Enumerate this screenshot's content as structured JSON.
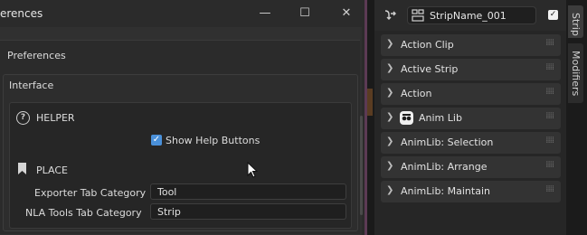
{
  "window": {
    "title": "erences",
    "minimize_glyph": "—",
    "maximize_glyph": "☐",
    "close_glyph": "✕"
  },
  "prefs": {
    "section_title": "Preferences",
    "interface_label": "Interface",
    "helper_label": "HELPER",
    "show_help_label": "Show Help Buttons",
    "show_help_checked": true,
    "place_label": "PLACE",
    "exporter_tab_label": "Exporter Tab Category",
    "exporter_tab_value": "Tool",
    "nla_tab_label": "NLA Tools Tab Category",
    "nla_tab_value": "Strip"
  },
  "sidebar": {
    "strip_name": "StripName_001",
    "strip_checked": true,
    "panels": [
      {
        "label": "Action Clip"
      },
      {
        "label": "Active Strip"
      },
      {
        "label": "Action"
      },
      {
        "label": "Anim Lib",
        "icon": "animlib-icon"
      },
      {
        "label": "AnimLib: Selection"
      },
      {
        "label": "AnimLib: Arrange"
      },
      {
        "label": "AnimLib: Maintain"
      }
    ],
    "tabs": [
      "Strip",
      "Modifiers"
    ]
  },
  "colors": {
    "accent": "#4a90d9",
    "divider": "#5c3a54"
  }
}
